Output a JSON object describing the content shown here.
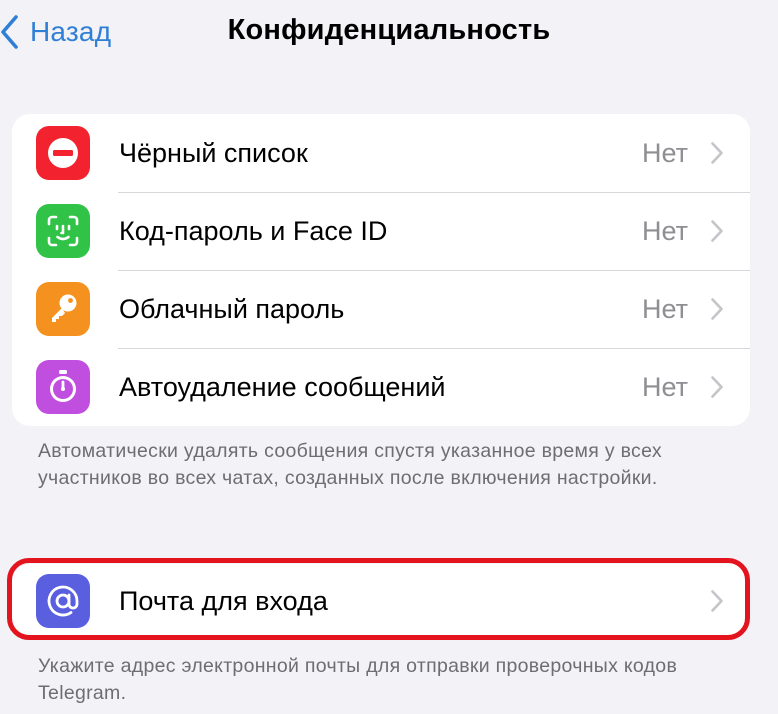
{
  "nav": {
    "back_label": "Назад",
    "title": "Конфиденциальность"
  },
  "privacy_items": [
    {
      "label": "Чёрный список",
      "value": "Нет",
      "icon": "blocked-icon",
      "icon_color": "#f2222f"
    },
    {
      "label": "Код-пароль и Face ID",
      "value": "Нет",
      "icon": "face-id-icon",
      "icon_color": "#30c348"
    },
    {
      "label": "Облачный пароль",
      "value": "Нет",
      "icon": "key-icon",
      "icon_color": "#f5921f"
    },
    {
      "label": "Автоудаление сообщений",
      "value": "Нет",
      "icon": "timer-icon",
      "icon_color": "#c04fe0"
    }
  ],
  "auto_delete_footnote": "Автоматически удалять сообщения спустя указанное время у всех участников во всех чатах, созданных после включения настройки.",
  "login_email": {
    "label": "Почта для входа",
    "icon": "at-sign-icon",
    "icon_color": "#5a5fe0"
  },
  "login_email_footnote": "Укажите адрес электронной почты для отправки проверочных кодов Telegram.",
  "colors": {
    "accent": "#2f7fd6",
    "background": "#f2f2f7",
    "highlight": "#e3141e"
  }
}
